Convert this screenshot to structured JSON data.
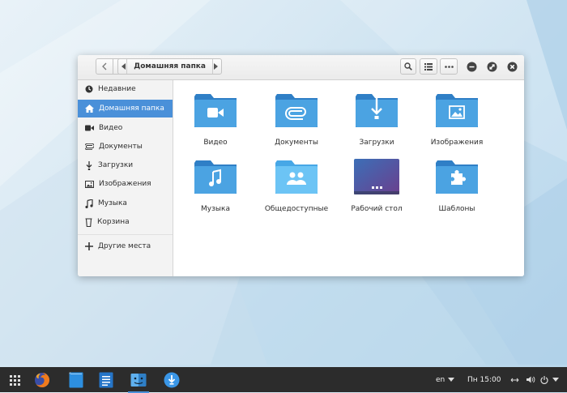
{
  "window": {
    "path_label": "Домашняя папка",
    "buttons": {
      "back": "back",
      "forward": "forward",
      "search": "search",
      "view": "list-view",
      "menu": "more"
    }
  },
  "sidebar": {
    "items": [
      {
        "label": "Недавние",
        "icon": "clock-icon"
      },
      {
        "label": "Домашняя папка",
        "icon": "home-icon",
        "active": true
      },
      {
        "label": "Видео",
        "icon": "video-icon"
      },
      {
        "label": "Документы",
        "icon": "paperclip-icon"
      },
      {
        "label": "Загрузки",
        "icon": "download-icon"
      },
      {
        "label": "Изображения",
        "icon": "image-icon"
      },
      {
        "label": "Музыка",
        "icon": "music-icon"
      },
      {
        "label": "Корзина",
        "icon": "trash-icon"
      }
    ],
    "other_places": "Другие места"
  },
  "folders": [
    {
      "label": "Видео",
      "icon": "video-folder-icon"
    },
    {
      "label": "Документы",
      "icon": "documents-folder-icon"
    },
    {
      "label": "Загрузки",
      "icon": "downloads-folder-icon"
    },
    {
      "label": "Изображения",
      "icon": "pictures-folder-icon"
    },
    {
      "label": "Музыка",
      "icon": "music-folder-icon"
    },
    {
      "label": "Общедоступные",
      "icon": "public-folder-icon"
    },
    {
      "label": "Рабочий стол",
      "icon": "desktop-folder-icon"
    },
    {
      "label": "Шаблоны",
      "icon": "templates-folder-icon"
    }
  ],
  "taskbar": {
    "language": "en",
    "clock": "Пн 15:00",
    "apps": [
      "apps-grid-icon",
      "firefox-icon",
      "notes-icon",
      "text-editor-icon",
      "file-manager-icon",
      "downloader-icon"
    ]
  },
  "colors": {
    "accent": "#4a90d9",
    "folder_dark": "#2f7fc6",
    "folder_light": "#4ba3e2",
    "taskbar": "#2c2c2c"
  }
}
